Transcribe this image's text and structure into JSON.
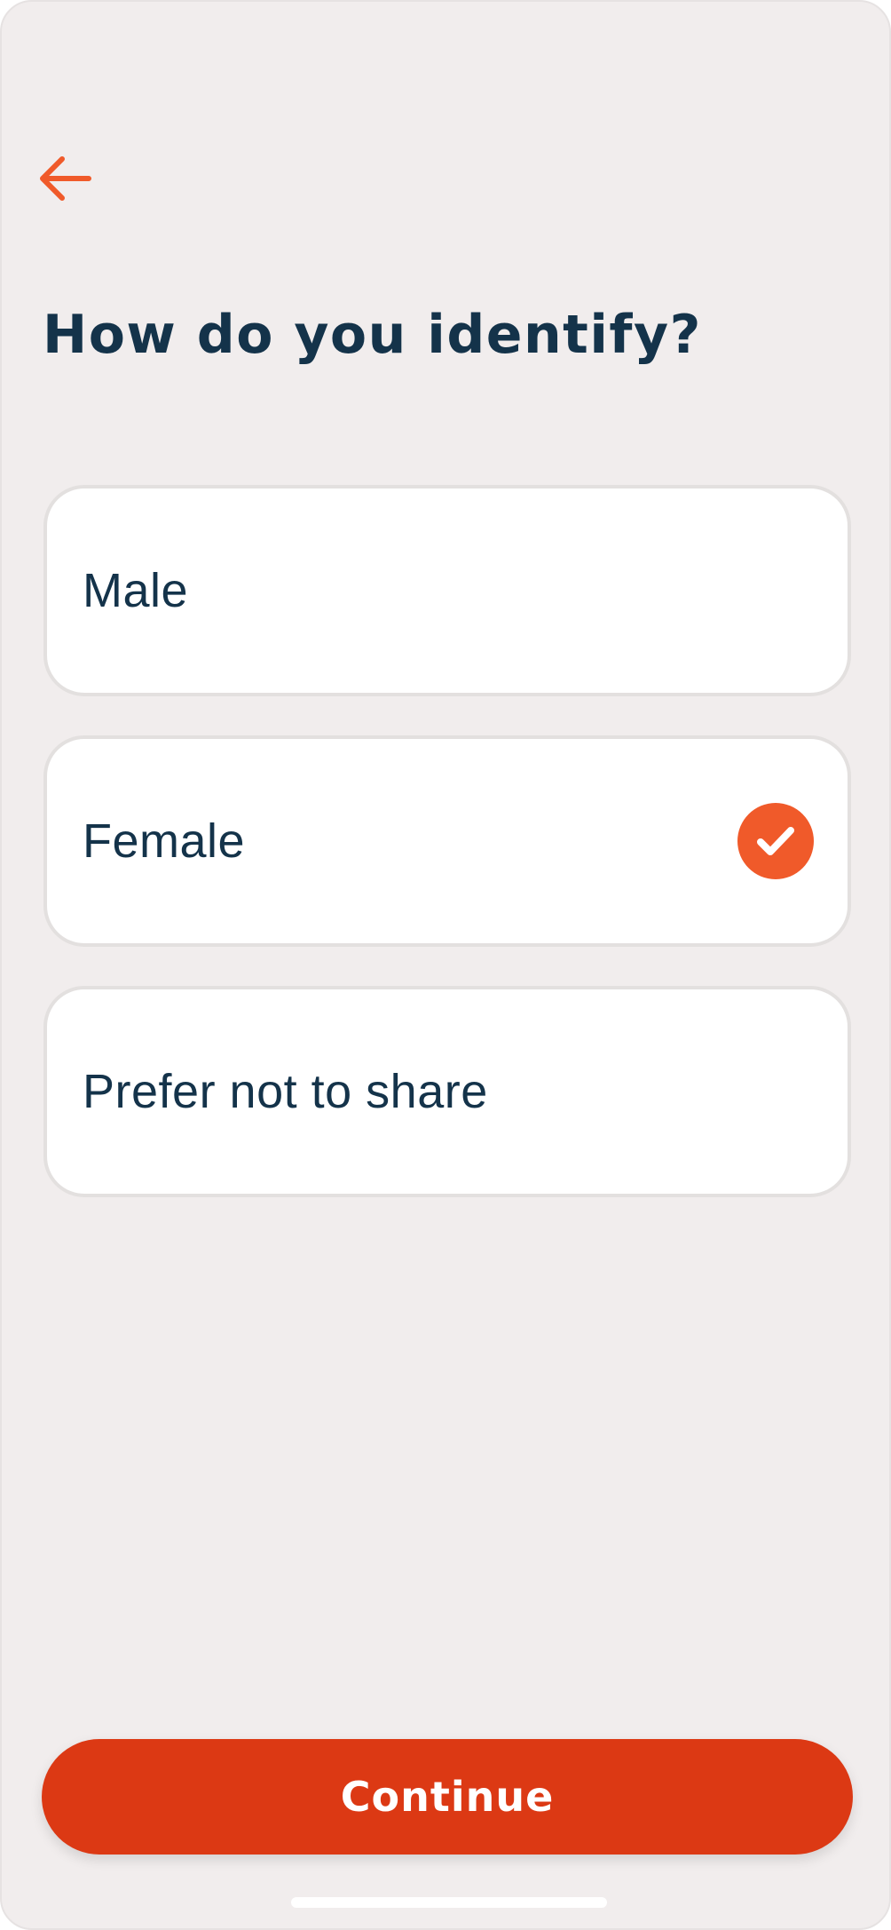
{
  "header": {
    "back_icon": "arrow-left-icon",
    "title": "How do you identify?"
  },
  "options": [
    {
      "label": "Male",
      "selected": false
    },
    {
      "label": "Female",
      "selected": true
    },
    {
      "label": "Prefer not to share",
      "selected": false
    }
  ],
  "footer": {
    "continue_label": "Continue"
  },
  "colors": {
    "accent": "#f05a2a",
    "button": "#dc3914",
    "text": "#14334a",
    "background": "#f1eded"
  },
  "icons": {
    "check": "checkmark-circle-icon"
  }
}
